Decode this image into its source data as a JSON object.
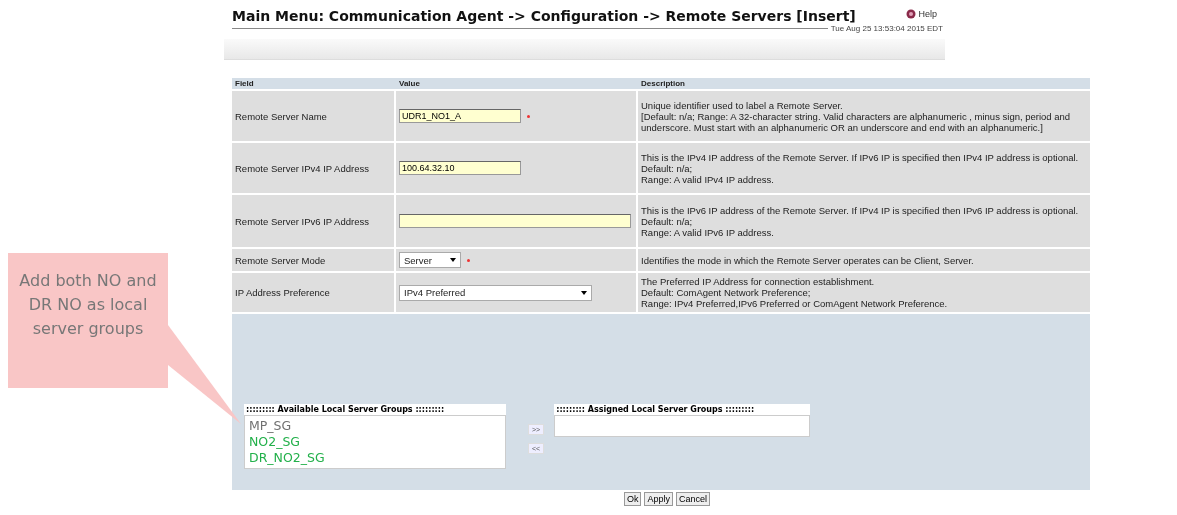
{
  "header": {
    "title": "Main Menu: Communication Agent -> Configuration -> Remote Servers [Insert]",
    "help": "Help",
    "timestamp": "Tue Aug 25 13:53:04 2015 EDT"
  },
  "table": {
    "columns": [
      "Field",
      "Value",
      "Description"
    ],
    "rows": [
      {
        "field": "Remote Server Name",
        "kind": "text",
        "value": "UDR1_NO1_A",
        "required": true,
        "description": [
          "Unique identifier used to label a Remote Server.",
          "[Default: n/a; Range: A 32-character string. Valid characters are alphanumeric , minus sign, period and underscore. Must start with an alphanumeric OR an underscore and end with an alphanumeric.]"
        ]
      },
      {
        "field": "Remote Server IPv4 IP Address",
        "kind": "text",
        "value": "100.64.32.10",
        "required": false,
        "description": [
          "This is the IPv4 IP address of the Remote Server. If IPv6 IP is specified then IPv4 IP address is optional.",
          "Default: n/a;",
          "Range: A valid IPv4 IP address."
        ]
      },
      {
        "field": "Remote Server IPv6 IP Address",
        "kind": "text",
        "required": false,
        "description": [
          "This is the IPv6 IP address of the Remote Server. If IPv4 IP is specified then IPv6 IP address is optional.",
          "Default: n/a;",
          "Range: A valid IPv6 IP address."
        ]
      },
      {
        "field": "Remote Server Mode",
        "kind": "select",
        "value": "Server",
        "required": true,
        "description": [
          "Identifies the mode in which the Remote Server operates can be Client, Server."
        ]
      },
      {
        "field": "IP Address Preference",
        "kind": "select",
        "value": "IPv4 Preferred",
        "required": false,
        "description": [
          "The Preferred IP Address for connection establishment.",
          "Default: ComAgent Network Preference;",
          "Range: IPv4 Preferred,IPv6 Preferred or ComAgent Network Preference."
        ]
      }
    ]
  },
  "groups": {
    "available_title": "::::::::: Available Local Server Groups :::::::::",
    "available": [
      {
        "label": "MP_SG",
        "color": "#707070"
      },
      {
        "label": "NO2_SG",
        "color": "#22b04a"
      },
      {
        "label": "DR_NO2_SG",
        "color": "#22b04a"
      }
    ],
    "add": ">>",
    "remove": "<<",
    "assigned_title": "::::::::: Assigned Local Server Groups :::::::::"
  },
  "buttons": [
    "Ok",
    "Apply",
    "Cancel"
  ],
  "callout": "Add both NO and DR NO as local server groups"
}
